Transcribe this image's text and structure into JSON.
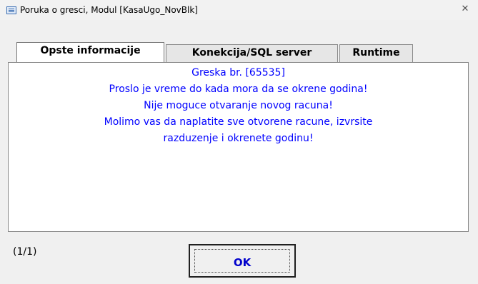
{
  "window": {
    "title": "Poruka o gresci, Modul [KasaUgo_NovBlk]",
    "icon": "form-icon",
    "close_glyph": "✕"
  },
  "tabs": [
    {
      "label": "Opste informacije",
      "active": true
    },
    {
      "label": "Konekcija/SQL server",
      "active": false
    },
    {
      "label": "Runtime",
      "active": false
    }
  ],
  "message": {
    "lines": [
      "Greska br. [65535]",
      "Proslo je vreme do kada mora da se okrene godina!",
      "Nije moguce otvaranje novog racuna!",
      "Molimo vas da naplatite sve otvorene racune, izvrsite",
      "razduzenje i okrenete godinu!"
    ],
    "color": "#0000ff"
  },
  "footer": {
    "counter": "(1/1)",
    "ok_label": "OK"
  }
}
